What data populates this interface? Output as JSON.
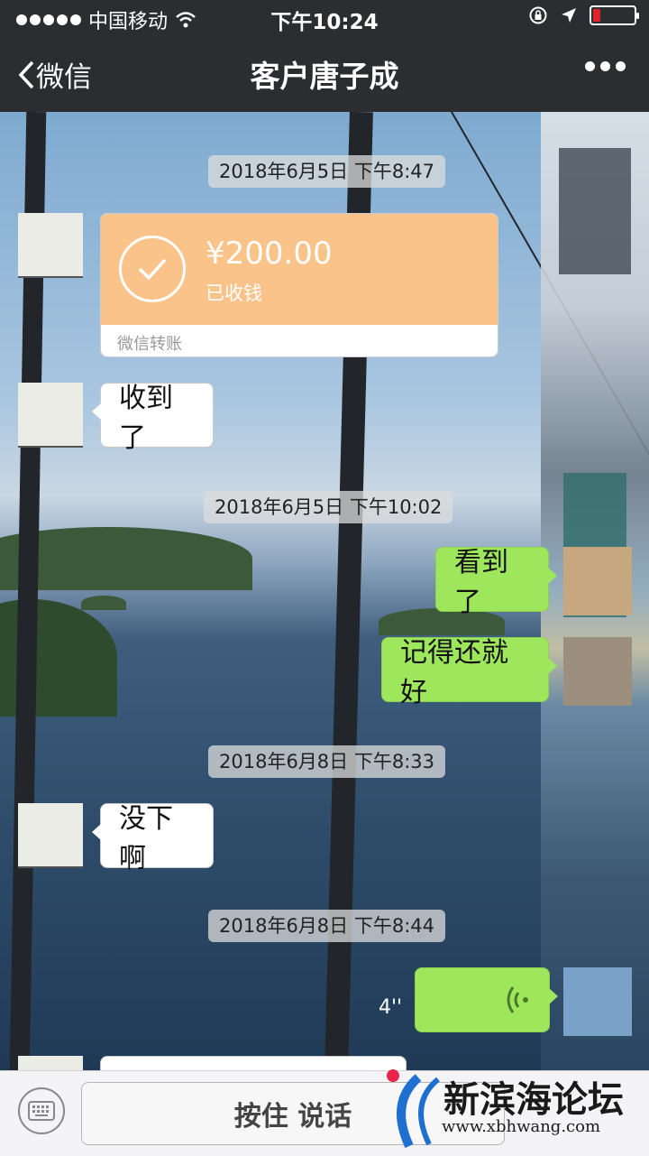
{
  "status_bar": {
    "carrier": "中国移动",
    "time": "下午10:24"
  },
  "nav": {
    "back_label": "微信",
    "title": "客户唐子成"
  },
  "messages": {
    "ts1": "2018年6月5日 下午8:47",
    "transfer": {
      "amount": "¥200.00",
      "status": "已收钱",
      "footer": "微信转账"
    },
    "m1": "收到了",
    "ts2": "2018年6月5日 下午10:02",
    "m2": "看到了",
    "m3": "记得还就好",
    "ts3": "2018年6月8日 下午8:33",
    "m4": "没下啊",
    "ts4": "2018年6月8日 下午8:44",
    "voice_length": "4''"
  },
  "input_bar": {
    "hold_to_talk": "按住 说话"
  },
  "watermark": {
    "name": "新滨海论坛",
    "url": "www.xbhwang.com"
  },
  "colors": {
    "nav_bg": "#2b2d31",
    "green_bubble": "#9ee65c",
    "transfer_orange": "#f9c38a",
    "battery_red": "#e0222b"
  }
}
